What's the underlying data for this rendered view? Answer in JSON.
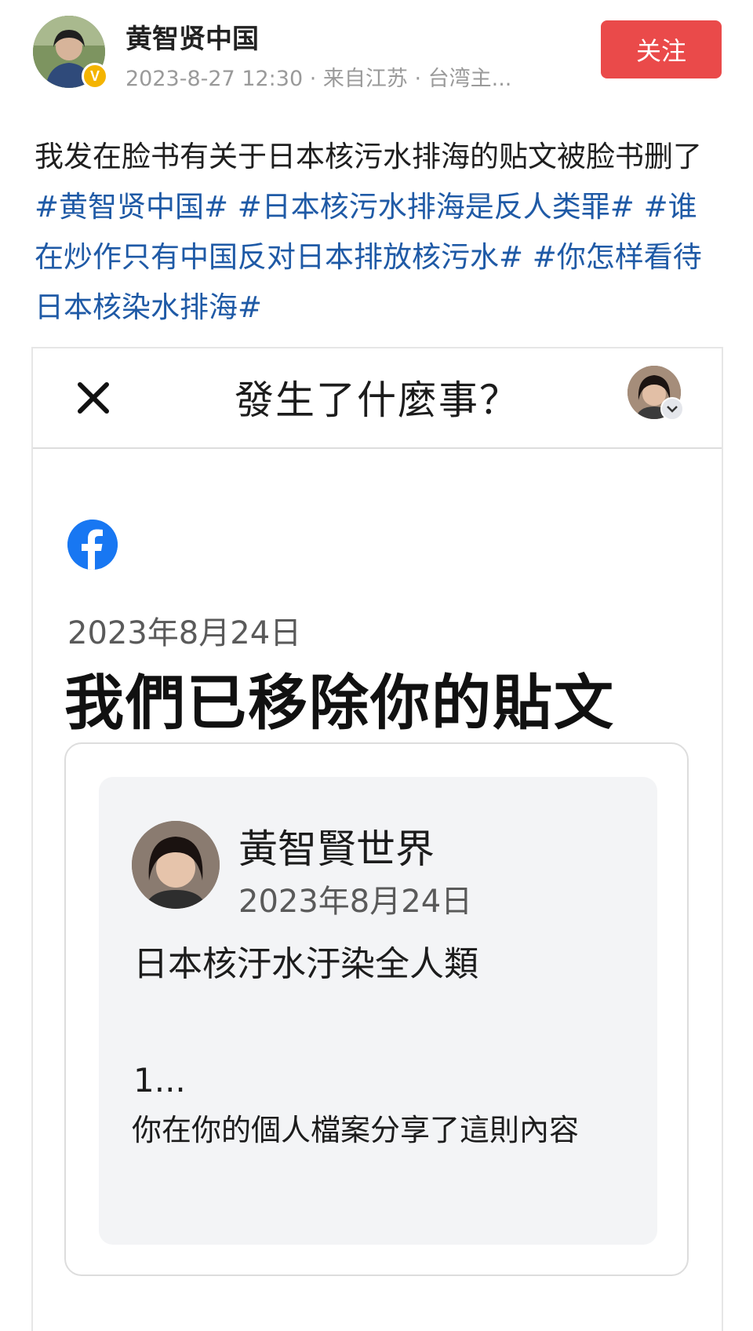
{
  "post": {
    "author": "黄智贤中国",
    "meta": "2023-8-27 12:30 · 来自江苏 · 台湾主...",
    "follow_label": "关注",
    "verified_mark": "V",
    "text": "我发在脸书有关于日本核污水排海的贴文被脸书删了",
    "hashtags": [
      "#黄智贤中国#",
      "#日本核污水排海是反人类罪#",
      "#谁在炒作只有中国反对日本排放核污水#",
      "#你怎样看待日本核染水排海#"
    ]
  },
  "facebook": {
    "top_title": "發生了什麼事？",
    "date": "2023年8月24日",
    "headline": "我們已移除你的貼文",
    "removed_post": {
      "page_name": "黃智賢世界",
      "date": "2023年8月24日",
      "text": "日本核汙水汙染全人類",
      "ellipsis": "1...",
      "share_note": "你在你的個人檔案分享了這則內容"
    },
    "brand_color": "#1877f2"
  },
  "colors": {
    "follow_button": "#ea4a4a",
    "hashtag": "#1f5aa6",
    "verified": "#f4b400"
  }
}
